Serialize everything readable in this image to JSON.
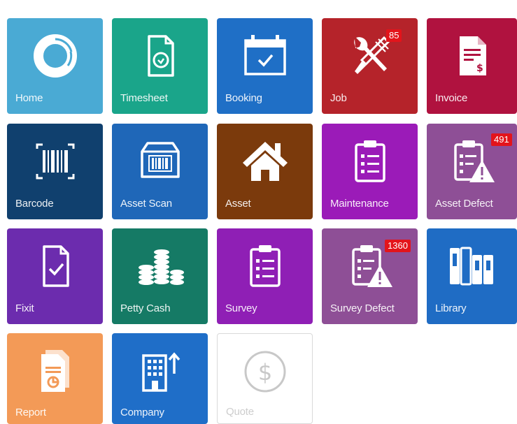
{
  "tiles": {
    "home": {
      "label": "Home",
      "color": "#4aaad4",
      "icon": "donut-chart-icon"
    },
    "timesheet": {
      "label": "Timesheet",
      "color": "#1aa58a",
      "icon": "clock-document-icon"
    },
    "booking": {
      "label": "Booking",
      "color": "#1f6fc6",
      "icon": "calendar-check-icon"
    },
    "job": {
      "label": "Job",
      "color": "#b5232a",
      "icon": "tools-icon",
      "badge": "85"
    },
    "invoice": {
      "label": "Invoice",
      "color": "#b0123f",
      "icon": "invoice-icon"
    },
    "barcode": {
      "label": "Barcode",
      "color": "#10406e",
      "icon": "barcode-icon"
    },
    "asset_scan": {
      "label": "Asset Scan",
      "color": "#1f67b8",
      "icon": "box-barcode-icon"
    },
    "asset": {
      "label": "Asset",
      "color": "#7b3a0c",
      "icon": "house-icon"
    },
    "maintenance": {
      "label": "Maintenance",
      "color": "#9b1bb8",
      "icon": "clipboard-list-icon"
    },
    "asset_defect": {
      "label": "Asset Defect",
      "color": "#8e4f96",
      "icon": "clipboard-warning-icon",
      "badge": "491"
    },
    "fixit": {
      "label": "Fixit",
      "color": "#6c2cae",
      "icon": "document-check-icon"
    },
    "petty_cash": {
      "label": "Petty Cash",
      "color": "#157a65",
      "icon": "coins-icon"
    },
    "survey": {
      "label": "Survey",
      "color": "#8f1fb5",
      "icon": "clipboard-list-icon"
    },
    "survey_defect": {
      "label": "Survey Defect",
      "color": "#8e4f96",
      "icon": "clipboard-warning-icon",
      "badge": "1360"
    },
    "library": {
      "label": "Library",
      "color": "#1f6cc4",
      "icon": "binders-icon"
    },
    "report": {
      "label": "Report",
      "color": "#f39a57",
      "icon": "report-chart-icon"
    },
    "company": {
      "label": "Company",
      "color": "#1f6ec8",
      "icon": "building-arrow-icon"
    },
    "quote": {
      "label": "Quote",
      "color": "#ffffff",
      "icon": "dollar-circle-icon"
    }
  }
}
